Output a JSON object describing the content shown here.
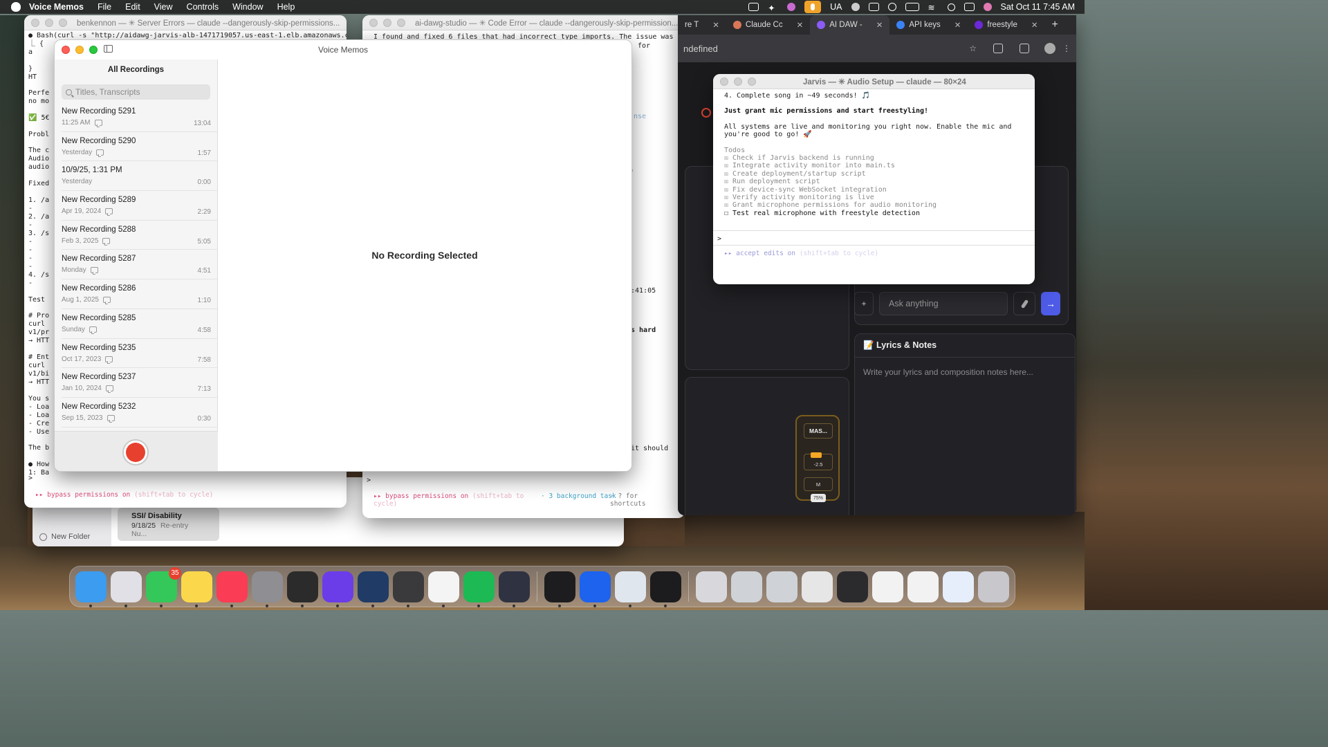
{
  "menubar": {
    "app": "Voice Memos",
    "items": [
      "File",
      "Edit",
      "View",
      "Controls",
      "Window",
      "Help"
    ],
    "input_source": "UA",
    "datetime": "Sat Oct 11  7:45 AM"
  },
  "terminal1": {
    "title": "benkennon — ✳ Server Errors — claude --dangerously-skip-permissions...",
    "lines": [
      "● Bash(curl -s \"http://aidawg-jarvis-alb-1471719057.us-east-1.elb.amazonaws.com/",
      "  ⎿ {",
      "    a",
      "",
      "    }",
      "    HT",
      "",
      "Perfe",
      "no mo",
      "",
      "✅ 5€",
      "",
      "Probl",
      "",
      "The c",
      "Audio",
      "audio",
      "",
      "Fixed",
      "",
      "1. /a",
      "   - ",
      "2. /a",
      "   - ",
      "3. /s",
      "   - ",
      "   - ",
      "   - ",
      "   - ",
      "4. /s",
      "   - ",
      "",
      "Test",
      "",
      "# Pro",
      "curl ",
      "v1/pr",
      "→ HTT",
      "",
      "# Ent",
      "curl ",
      "v1/bi",
      "→ HTT",
      "",
      "You s",
      "- Loa",
      "- Loa",
      "- Cre",
      "- Use",
      "",
      "The b",
      "",
      "● How i",
      "1: Ba"
    ],
    "prompt": ">",
    "status": "▸▸ bypass permissions on",
    "status_hint": "(shift+tab to cycle)"
  },
  "terminal2": {
    "title": "ai-dawg-studio — ✳ Code Error — claude --dangerously-skip-permission...",
    "first_line": "I found and fixed 6 files that had incorrect type imports. The issue was",
    "frag1": "for",
    "frag2": "nse",
    "frag3": "0",
    "frag4": ":41:05",
    "frag5": "s hard",
    "frag6": "it should",
    "prompt": ">",
    "status": "▸▸ bypass permissions on",
    "status_hint": "(shift+tab to cycle)",
    "bg_task": "· 3 background task",
    "shortcuts": "· ? for shortcuts"
  },
  "notes": {
    "card_title": "SSI/ Disability",
    "card_date": "9/18/25",
    "card_preview": "Re-entry Nu...",
    "new_folder": "New Folder"
  },
  "browser": {
    "tabs": [
      {
        "label": "re T",
        "color": "#888"
      },
      {
        "label": "Claude Cc",
        "color": "#d97757"
      },
      {
        "label": "AI DAW -",
        "color": "#8b5cf6"
      },
      {
        "label": "API keys",
        "color": "#3b82f6"
      },
      {
        "label": "freestyle",
        "color": "#6d28d9"
      }
    ],
    "url": "ndefined",
    "ask_placeholder": "Ask anything",
    "lyrics_title": "📝 Lyrics & Notes",
    "lyrics_placeholder": "Write your lyrics and composition notes here...",
    "mixer_label": "MAS...",
    "mixer_value": "-2.5",
    "mixer_mute": "M",
    "mixer_pct": "75%"
  },
  "jarvis": {
    "title": "Jarvis — ✳ Audio Setup — claude — 80×24",
    "line1": "4. Complete song in ~49 seconds! 🎵",
    "line2": "Just grant mic permissions and start freestyling!",
    "line3": "All systems are live and monitoring you right now. Enable the mic and",
    "line4": "you're good to go! 🚀",
    "todos_header": "Todos",
    "todos": [
      "☒ Check if Jarvis backend is running",
      "☒ Integrate activity monitor into main.ts",
      "☒ Create deployment/startup script",
      "☒ Run deployment script",
      "☒ Fix device-sync WebSocket integration",
      "☒ Verify activity monitoring is live",
      "☒ Grant microphone permissions for audio monitoring"
    ],
    "todo_pending": "☐ Test real microphone with freestyle detection",
    "prompt": ">",
    "accept": "▸▸ accept edits on",
    "accept_hint": "(shift+tab to cycle)"
  },
  "voice_memos": {
    "window_title": "Voice Memos",
    "list_title": "All Recordings",
    "search_placeholder": "Titles, Transcripts",
    "recordings": [
      {
        "name": "New Recording 5291",
        "date": "11:25 AM",
        "duration": "13:04",
        "transcript": true
      },
      {
        "name": "New Recording 5290",
        "date": "Yesterday",
        "duration": "1:57",
        "transcript": true
      },
      {
        "name": "10/9/25, 1:31 PM",
        "date": "Yesterday",
        "duration": "0:00",
        "transcript": false
      },
      {
        "name": "New Recording 5289",
        "date": "Apr 19, 2024",
        "duration": "2:29",
        "transcript": true
      },
      {
        "name": "New Recording 5288",
        "date": "Feb 3, 2025",
        "duration": "5:05",
        "transcript": true
      },
      {
        "name": "New Recording 5287",
        "date": "Monday",
        "duration": "4:51",
        "transcript": true
      },
      {
        "name": "New Recording 5286",
        "date": "Aug 1, 2025",
        "duration": "1:10",
        "transcript": true
      },
      {
        "name": "New Recording 5285",
        "date": "Sunday",
        "duration": "4:58",
        "transcript": true
      },
      {
        "name": "New Recording 5235",
        "date": "Oct 17, 2023",
        "duration": "7:58",
        "transcript": true
      },
      {
        "name": "New Recording 5237",
        "date": "Jan 10, 2024",
        "duration": "7:13",
        "transcript": true
      },
      {
        "name": "New Recording 5232",
        "date": "Sep 15, 2023",
        "duration": "0:30",
        "transcript": true
      }
    ],
    "empty_state": "No Recording Selected"
  },
  "dock": {
    "apps": [
      {
        "name": "finder-icon",
        "color": "#3b9cf0"
      },
      {
        "name": "launchpad-icon",
        "color": "#e0e0e6"
      },
      {
        "name": "messages-icon",
        "color": "#34c759",
        "badge": "35"
      },
      {
        "name": "notes-icon",
        "color": "#fbd84b"
      },
      {
        "name": "music-icon",
        "color": "#fa3c55"
      },
      {
        "name": "system-settings-icon",
        "color": "#8e8e93"
      },
      {
        "name": "audio-app-icon",
        "color": "#2b2b2b"
      },
      {
        "name": "arc-app-icon",
        "color": "#6a3de8"
      },
      {
        "name": "mixer-app-icon",
        "color": "#1f3b66"
      },
      {
        "name": "audio-utility-icon",
        "color": "#3a3a3c"
      },
      {
        "name": "chrome-icon",
        "color": "#f4f4f4"
      },
      {
        "name": "spotify-icon",
        "color": "#1db954"
      },
      {
        "name": "electron-icon",
        "color": "#2f3241"
      },
      {
        "name": "terminal-icon",
        "color": "#1d1d1f"
      },
      {
        "name": "docker-icon",
        "color": "#1d63ed"
      },
      {
        "name": "preview-icon",
        "color": "#dfe6ee"
      },
      {
        "name": "voice-memos-icon",
        "color": "#1c1c1e"
      },
      {
        "name": "music-doc-icon",
        "color": "#d8d8dc"
      },
      {
        "name": "window-thumb-1-icon",
        "color": "#cfd3d8"
      },
      {
        "name": "window-thumb-2-icon",
        "color": "#cfd3d8"
      },
      {
        "name": "window-thumb-3-icon",
        "color": "#e6e6e6"
      },
      {
        "name": "window-thumb-4-icon",
        "color": "#2b2b2e"
      },
      {
        "name": "window-thumb-5-icon",
        "color": "#f2f2f2"
      },
      {
        "name": "window-thumb-6-icon",
        "color": "#f2f2f2"
      },
      {
        "name": "window-thumb-7-icon",
        "color": "#e6eefb"
      },
      {
        "name": "trash-icon",
        "color": "#c7c7cc"
      }
    ]
  }
}
